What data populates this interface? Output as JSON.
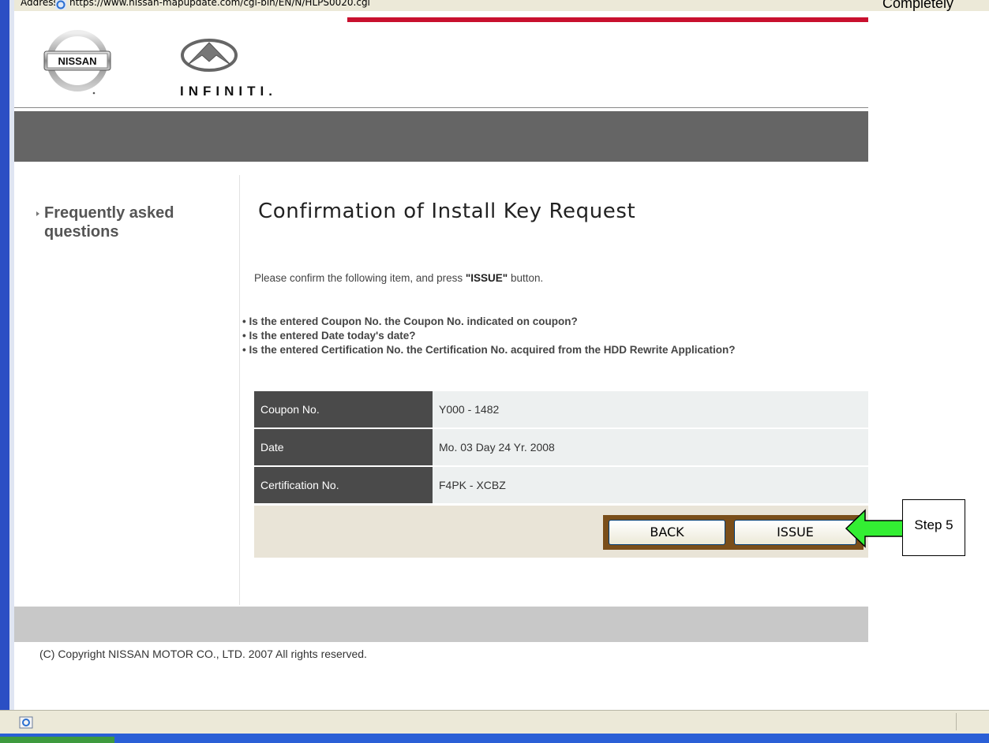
{
  "browser": {
    "address_label": "Address",
    "url": "https://www.nissan-mapupdate.com/cgi-bin/EN/N/HLPS0020.cgi",
    "top_right_text": "Completely"
  },
  "brands": {
    "nissan": "NISSAN",
    "infiniti": "INFINITI."
  },
  "sidebar": {
    "faq_label": "Frequently asked questions"
  },
  "main": {
    "title": "Confirmation of Install Key Request",
    "intro_prefix": "Please confirm the following item, and press ",
    "intro_emphasis": "\"ISSUE\"",
    "intro_suffix": " button.",
    "checks": [
      "• Is the entered Coupon No. the Coupon No. indicated on coupon?",
      "• Is the entered Date today's date?",
      "• Is the entered Certification No. the Certification No. acquired from the HDD Rewrite Application?"
    ],
    "rows": [
      {
        "label": "Coupon No.",
        "value": "Y000 - 1482"
      },
      {
        "label": "Date",
        "value": "Mo. 03 Day 24 Yr. 2008"
      },
      {
        "label": "Certification No.",
        "value": "F4PK - XCBZ"
      }
    ],
    "back_button": "BACK",
    "issue_button": "ISSUE"
  },
  "annotation": {
    "step_label": "Step 5",
    "arrow_color": "#33ee33"
  },
  "footer": {
    "copyright": "(C) Copyright NISSAN MOTOR CO., LTD. 2007 All rights reserved."
  },
  "colors": {
    "accent_red": "#c8102e",
    "header_band": "#656565",
    "label_cell": "#4a4a4a",
    "button_frame": "#7a4e1a"
  }
}
